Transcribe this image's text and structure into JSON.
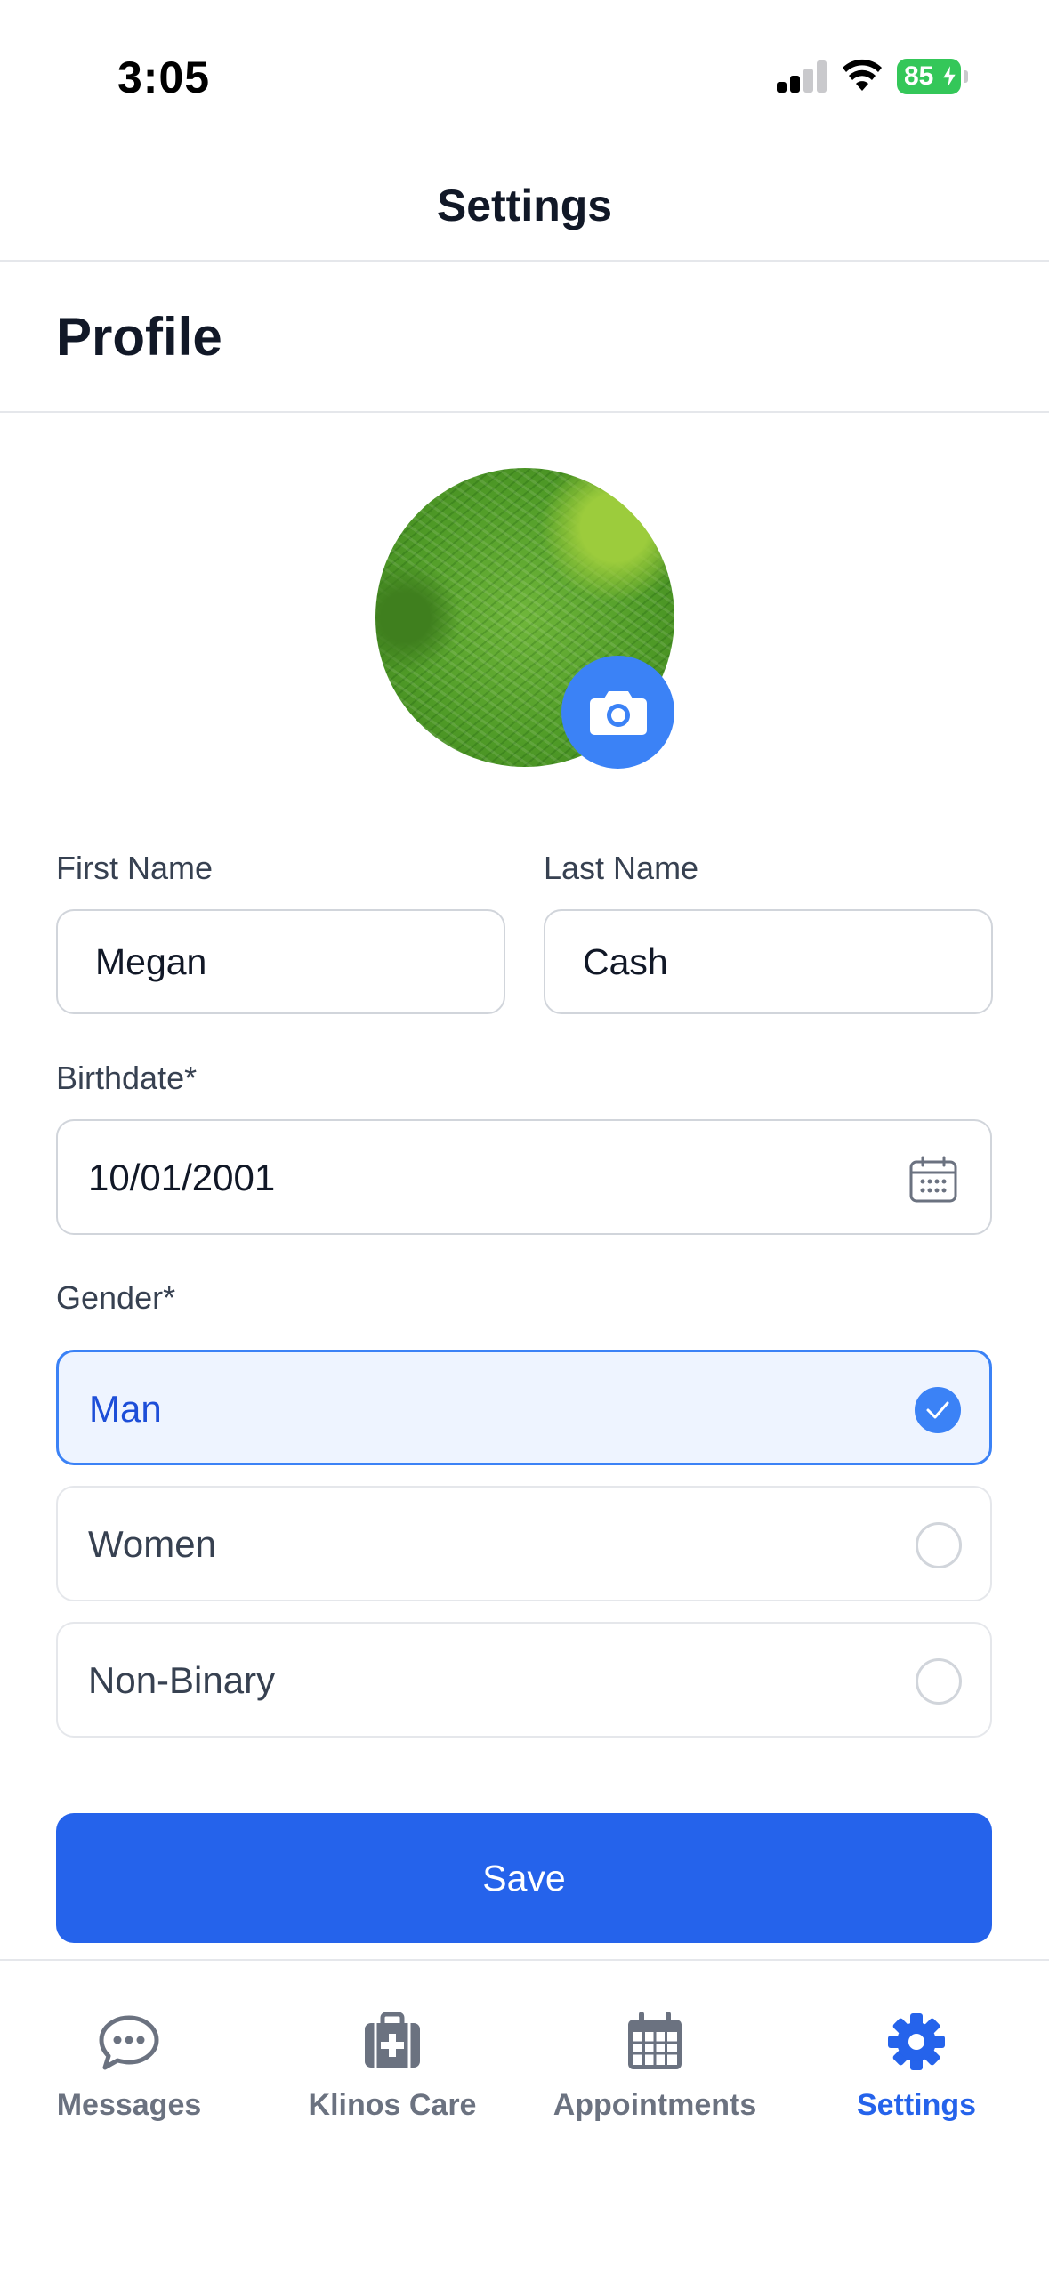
{
  "status_bar": {
    "time": "3:05",
    "battery": "85"
  },
  "header": {
    "title": "Settings"
  },
  "section": {
    "title": "Profile"
  },
  "form": {
    "first_name": {
      "label": "First Name",
      "value": "Megan"
    },
    "last_name": {
      "label": "Last Name",
      "value": "Cash"
    },
    "birthdate": {
      "label": "Birthdate*",
      "value": "10/01/2001"
    },
    "gender": {
      "label": "Gender*",
      "options": [
        {
          "label": "Man",
          "selected": true
        },
        {
          "label": "Women",
          "selected": false
        },
        {
          "label": "Non-Binary",
          "selected": false
        }
      ]
    },
    "save_label": "Save"
  },
  "tabs": [
    {
      "label": "Messages",
      "icon": "chat-bubble-icon",
      "active": false
    },
    {
      "label": "Klinos Care",
      "icon": "medical-kit-icon",
      "active": false
    },
    {
      "label": "Appointments",
      "icon": "calendar-icon",
      "active": false
    },
    {
      "label": "Settings",
      "icon": "gear-icon",
      "active": true
    }
  ],
  "colors": {
    "accent": "#2563eb",
    "selected_bg": "#eef4ff",
    "battery": "#34c759",
    "inactive_tab": "#6b7280"
  }
}
